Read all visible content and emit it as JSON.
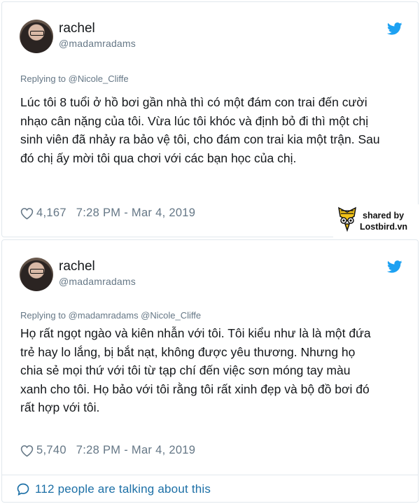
{
  "tweets": [
    {
      "author_name": "rachel",
      "author_handle": "@madamradams",
      "replying_prefix": "Replying to",
      "replying_to": "@Nicole_Cliffe",
      "lines": [
        "Lúc tôi 8 tuổi ở hồ bơi gần nhà thì có một đám con trai đến cười",
        "nhạo cân nặng của tôi. Vừa lúc tôi khóc và định bỏ đi thì một chị",
        "sinh viên đã nhảy ra bảo vệ tôi, cho đám con trai kia một trận. Sau",
        "đó chị ấy mời tôi qua chơi với các bạn học của chị."
      ],
      "likes": "4,167",
      "timestamp": "7:28 PM - Mar 4, 2019"
    },
    {
      "author_name": "rachel",
      "author_handle": "@madamradams",
      "replying_prefix": "Replying to",
      "replying_to": "@madamradams @Nicole_Cliffe",
      "lines": [
        "Họ rất ngọt ngào và kiên nhẫn với tôi. Tôi kiểu như là là một đứa",
        "trẻ hay lo lắng, bị bắt nạt, không được yêu thương. Nhưng họ",
        "chia sẻ mọi thứ với tôi từ tạp chí đến việc sơn móng tay màu",
        "xanh cho tôi. Họ bảo với tôi rằng tôi rất xinh đẹp và bộ đồ bơi đó",
        "rất hợp với tôi."
      ],
      "likes": "5,740",
      "timestamp": "7:28 PM - Mar 4, 2019"
    }
  ],
  "watermark": {
    "line1": "shared by",
    "line2": "Lostbird.vn"
  },
  "footer": {
    "talking_text": "112 people are talking about this"
  },
  "icons": {
    "bird": "twitter-bird-icon",
    "heart": "heart-outline-icon",
    "comment": "speech-bubble-icon",
    "logo": "lostbird-logo-icon"
  },
  "colors": {
    "twitter_blue": "#1da1f2",
    "secondary_text": "#657786",
    "primary_text": "#14171a",
    "border": "#e1e8ed",
    "link_dark": "#1b6fa6"
  }
}
